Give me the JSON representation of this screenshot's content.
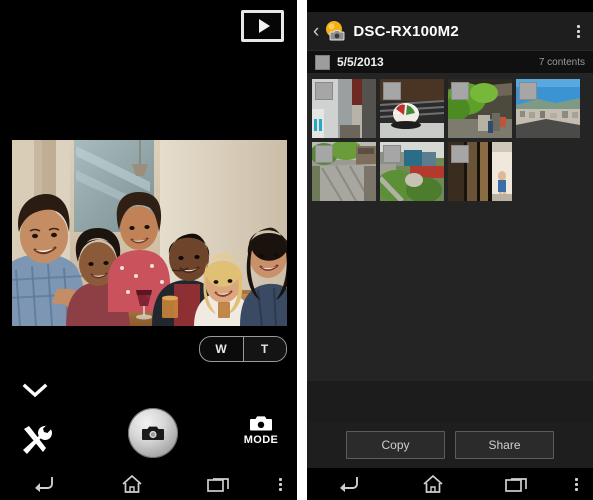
{
  "left_panel": {
    "name": "camera-remote-live-view",
    "playback_button": {
      "icon": "playback-icon",
      "label": ""
    },
    "zoom_control": {
      "wide_label": "W",
      "tele_label": "T"
    },
    "expand_chevron": {
      "icon": "chevron-down-icon"
    },
    "settings": {
      "icon": "tools-icon"
    },
    "shutter": {
      "icon": "camera-shutter-icon"
    },
    "mode": {
      "icon": "camera-icon",
      "label": "MODE"
    }
  },
  "right_panel": {
    "name": "device-contents-browser",
    "header": {
      "back_icon": "back-chevron-icon",
      "device_icon": "camera-device-icon",
      "title": "DSC-RX100M2",
      "overflow_icon": "overflow-menu-icon"
    },
    "date_group": {
      "checkbox_state": "unchecked",
      "date": "5/5/2013",
      "count": "7 contents"
    },
    "thumbnails": [
      {
        "id": "thumb-1",
        "alt": "narrow-alley-street",
        "checkbox": "unchecked"
      },
      {
        "id": "thumb-2",
        "alt": "red-white-ball-on-grate",
        "checkbox": "unchecked"
      },
      {
        "id": "thumb-3",
        "alt": "green-trees-under-eaves",
        "checkbox": "unchecked"
      },
      {
        "id": "thumb-4",
        "alt": "town-rooftops-blue-sky",
        "checkbox": "unchecked"
      },
      {
        "id": "thumb-5",
        "alt": "stone-paved-lane",
        "checkbox": "unchecked"
      },
      {
        "id": "thumb-6",
        "alt": "garden-path-with-red-building",
        "checkbox": "unchecked"
      },
      {
        "id": "thumb-7",
        "alt": "wooden-doorway-with-child",
        "checkbox": "unchecked"
      }
    ],
    "actions": {
      "copy_label": "Copy",
      "share_label": "Share"
    }
  },
  "navbar": {
    "back_icon": "back-arrow-icon",
    "home_icon": "home-icon",
    "recents_icon": "recent-apps-icon",
    "menu_icon": "overflow-menu-icon"
  },
  "colors": {
    "accent_yellow": "#f2a615",
    "panel_bg": "#1c1c1c",
    "grid_bg": "#242424",
    "text_primary": "#ffffff",
    "text_secondary": "#9a9a9a"
  }
}
